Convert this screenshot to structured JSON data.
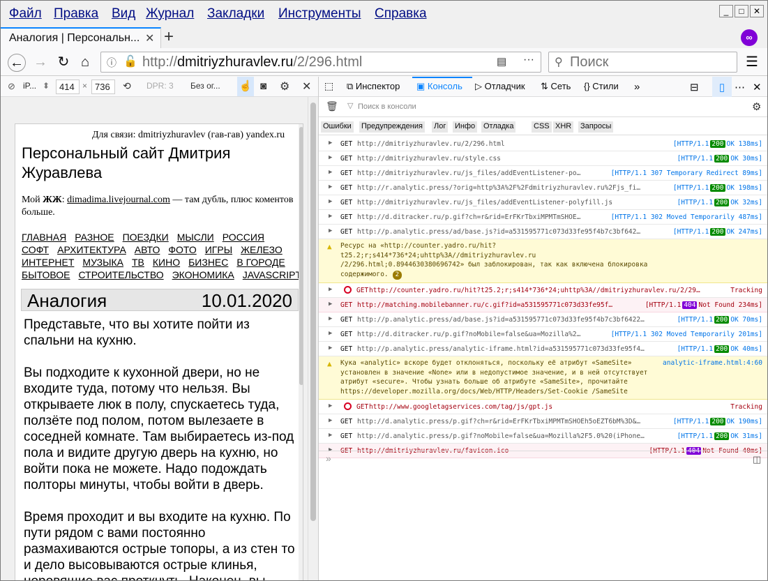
{
  "menu": [
    "Файл",
    "Правка",
    "Вид",
    "Журнал",
    "Закладки",
    "Инструменты",
    "Справка"
  ],
  "window_buttons": {
    "minimize": "_",
    "maximize": "□",
    "close": "✕"
  },
  "tab": {
    "title": "Аналогия | Персональн...",
    "close": "✕",
    "new_tab": "+"
  },
  "url": {
    "prefix": "http://",
    "host": "dmitriyzhuravlev.ru",
    "path": "/2/296.html"
  },
  "search": {
    "placeholder": "Поиск"
  },
  "rdm": {
    "device": "iP...",
    "width": "414",
    "x": "×",
    "height": "736",
    "dpr": "DPR: 3",
    "throttle": "Без ог..."
  },
  "page": {
    "contact": "Для связи: dmitriyzhuravlev (гав-гав) yandex.ru",
    "site_title": "Персональный сайт Дмитрия Журавлева",
    "lj_prefix": "Мой ",
    "lj_bold": "ЖЖ",
    "lj_colon": ": ",
    "lj_link": "dimadima.livejournal.com",
    "lj_suffix": " — там дубль, плюс коментов больше.",
    "nav_rows": [
      [
        "ГЛАВНАЯ",
        "РАЗНОЕ",
        "ПОЕЗДКИ",
        "МЫСЛИ",
        "РОССИЯ"
      ],
      [
        "СОФТ",
        "АРХИТЕКТУРА",
        "АВТО",
        "ФОТО",
        "ИГРЫ",
        "ЖЕЛЕЗО"
      ],
      [
        "ИНТЕРНЕТ",
        "МУЗЫКА",
        "ТВ",
        "КИНО",
        "БИЗНЕС",
        "В ГОРОДЕ"
      ],
      [
        "БЫТОВОЕ",
        "СТРОИТЕЛЬСТВО",
        "ЭКОНОМИКА",
        "JAVASCRIPT"
      ]
    ],
    "post_title": "Аналогия",
    "post_date": "10.01.2020",
    "paragraphs": [
      "Представьте, что вы хотите пойти из спальни на кухню.",
      "Вы подходите к кухонной двери, но не входите туда, потому что нельзя. Вы открываете люк в полу, спускаетесь туда, ползёте под полом, потом вылезаете в соседней комнате. Там выбираетесь из-под пола и видите другую дверь на кухню, но войти пока не можете. Надо подождать полторы минуты, чтобы войти в дверь.",
      "Время проходит и вы входите на кухню. По пути рядом с вами постоянно размахиваются острые топоры, а из стен то и дело высовываются острые клинья, норовящие вас проткнуть. Наконец, вы"
    ]
  },
  "devtools": {
    "tabs": [
      "Инспектор",
      "Консоль",
      "Отладчик",
      "Сеть",
      "Стили"
    ],
    "filter_placeholder": "Поиск в консоли",
    "filters": [
      "Ошибки",
      "Предупреждения",
      "Лог",
      "Инфо",
      "Отладка",
      "CSS",
      "XHR",
      "Запросы"
    ],
    "entries": [
      {
        "kind": "req",
        "method": "GET",
        "url": "http://dmitriyzhuravlev.ru/2/296.html",
        "proto": "[HTTP/1.1",
        "code": "200",
        "text": "OK 138ms]"
      },
      {
        "kind": "req",
        "method": "GET",
        "url": "http://dmitriyzhuravlev.ru/style.css",
        "proto": "[HTTP/1.1",
        "code": "200",
        "text": "OK 30ms]"
      },
      {
        "kind": "req",
        "method": "GET",
        "url": "http://dmitriyzhuravlev.ru/js_files/addEventListener-po…",
        "proto": "[HTTP/1.1",
        "code": "307",
        "text": "Temporary Redirect 89ms]",
        "plain": true
      },
      {
        "kind": "req",
        "method": "GET",
        "url": "http://r.analytic.press/?orig=http%3A%2F%2Fdmitriyzhuravlev.ru%2Fjs_fi…",
        "proto": "[HTTP/1.1",
        "code": "200",
        "text": "OK 198ms]"
      },
      {
        "kind": "req",
        "method": "GET",
        "url": "http://dmitriyzhuravlev.ru/js_files/addEventListener-polyfill.js",
        "proto": "[HTTP/1.1",
        "code": "200",
        "text": "OK 32ms]"
      },
      {
        "kind": "req",
        "method": "GET",
        "url": "http://d.ditracker.ru/p.gif?ch=r&rid=ErFKrTbxiMPMTmSHOE…",
        "proto": "[HTTP/1.1",
        "code": "302",
        "text": "Moved Temporarily 487ms]",
        "plain": true
      },
      {
        "kind": "req",
        "method": "GET",
        "url": "http://p.analytic.press/ad/base.js?id=a531595771c073d33fe95f4b7c3bf642…",
        "proto": "[HTTP/1.1",
        "code": "200",
        "text": "OK 247ms]"
      },
      {
        "kind": "warn",
        "text": "Ресурс на «http://counter.yadro.ru/hit?t25.2;r;s414*736*24;uhttp%3A//dmitriyzhuravlev.ru /2/296.html;0.8944630380696742» был заблокирован, так как включена блокировка содержимого.",
        "count": "2"
      },
      {
        "kind": "blk",
        "method": "GET",
        "url": "http://counter.yadro.ru/hit?t25.2;r;s414*736*24;uhttp%3A//dmitriyzhuravlev.ru/2/29…",
        "text": "Tracking"
      },
      {
        "kind": "err",
        "method": "GET",
        "url": "http://matching.mobilebanner.ru/c.gif?id=a531595771c073d33fe95f…",
        "proto": "[HTTP/1.1",
        "code": "404",
        "text": "Not Found 234ms]"
      },
      {
        "kind": "req",
        "method": "GET",
        "url": "http://p.analytic.press/ad/base.js?id=a531595771c073d33fe95f4b7c3bf6422…",
        "proto": "[HTTP/1.1",
        "code": "200",
        "text": "OK 70ms]"
      },
      {
        "kind": "req",
        "method": "GET",
        "url": "http://d.ditracker.ru/p.gif?noMobile=false&ua=Mozilla%2…",
        "proto": "[HTTP/1.1",
        "code": "302",
        "text": "Moved Temporarily 201ms]",
        "plain": true
      },
      {
        "kind": "req",
        "method": "GET",
        "url": "http://p.analytic.press/analytic-iframe.html?id=a531595771c073d33fe95f4…",
        "proto": "[HTTP/1.1",
        "code": "200",
        "text": "OK 40ms]"
      },
      {
        "kind": "warn",
        "text": "Кука «analytic» вскоре будет отклоняться, поскольку её атрибут «SameSite» установлен в значение «None» или в недопустимое значение, и в ней отсутствует атрибут «secure». Чтобы узнать больше об атрибуте «SameSite», прочитайте https://developer.mozilla.org/docs/Web/HTTP/Headers/Set-Cookie /SameSite",
        "source": "analytic-iframe.html:4:60"
      },
      {
        "kind": "blk",
        "method": "GET",
        "url": "http://www.googletagservices.com/tag/js/gpt.js",
        "text": "Tracking"
      },
      {
        "kind": "req",
        "method": "GET",
        "url": "http://d.analytic.press/p.gif?ch=r&rid=ErFKrTbxiMPMTmSHOEh5oEZT6bM%3D&…",
        "proto": "[HTTP/1.1",
        "code": "200",
        "text": "OK 190ms]"
      },
      {
        "kind": "req",
        "method": "GET",
        "url": "http://d.analytic.press/p.gif?noMobile=false&ua=Mozilla%2F5.0%20(iPhone…",
        "proto": "[HTTP/1.1",
        "code": "200",
        "text": "OK 31ms]"
      },
      {
        "kind": "err",
        "method": "GET",
        "url": "http://dmitriyzhuravlev.ru/favicon.ico",
        "proto": "[HTTP/1.1",
        "code": "404",
        "text": "Not Found 40ms]"
      }
    ],
    "prompt": "»"
  }
}
